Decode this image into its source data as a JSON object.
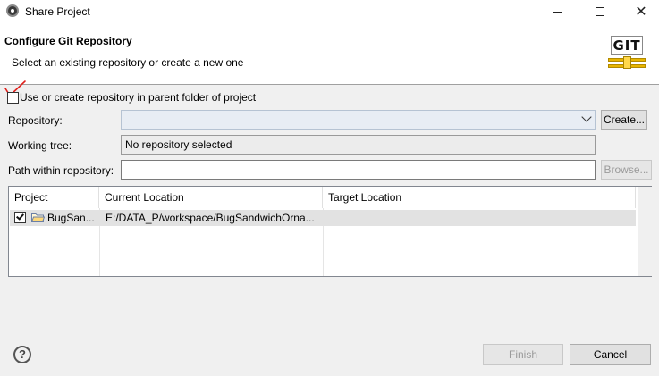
{
  "window": {
    "title": "Share Project",
    "controls": [
      "minimize",
      "maximize",
      "close"
    ]
  },
  "header": {
    "title": "Configure Git Repository",
    "subtitle": "Select an existing repository or create a new one",
    "logo_text": "GIT"
  },
  "form": {
    "use_parent_label": "Use or create repository in parent folder of project",
    "use_parent_checked": false,
    "repository_label": "Repository:",
    "repository_value": "",
    "create_button": "Create...",
    "working_tree_label": "Working tree:",
    "working_tree_value": "No repository selected",
    "path_label": "Path within repository:",
    "path_value": "",
    "browse_button": "Browse..."
  },
  "table": {
    "columns": [
      "Project",
      "Current Location",
      "Target Location"
    ],
    "rows": [
      {
        "checked": true,
        "project": "BugSan...",
        "current_location": "E:/DATA_P/workspace/BugSandwichOrna...",
        "target_location": ""
      }
    ]
  },
  "footer": {
    "help_icon": "question-icon",
    "finish_button": "Finish",
    "cancel_button": "Cancel"
  },
  "colors": {
    "annotation_check": "#e0201c",
    "selection_row": "#e2e2e2",
    "dialog_bg": "#f0f0f0"
  }
}
